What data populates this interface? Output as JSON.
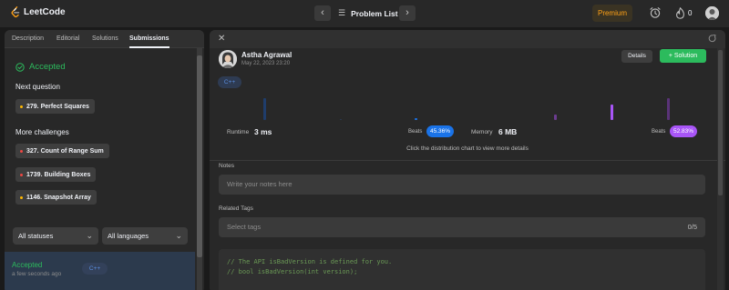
{
  "app": {
    "logo_text": "LeetCode"
  },
  "header": {
    "prev_glyph": "‹",
    "next_glyph": "›",
    "problem_list_label": "Problem List",
    "premium_label": "Premium",
    "streak_count": "0",
    "colors": {
      "premium": "#ffa116"
    }
  },
  "left": {
    "tabs": [
      {
        "label": "Description"
      },
      {
        "label": "Editorial"
      },
      {
        "label": "Solutions"
      },
      {
        "label": "Submissions",
        "active": true
      }
    ],
    "status": "Accepted",
    "next_question_label": "Next question",
    "next_question": {
      "label": "279. Perfect Squares",
      "difficulty_color": "#ffb800"
    },
    "more_challenges_label": "More challenges",
    "challenges": [
      {
        "label": "327. Count of Range Sum",
        "difficulty_color": "#ef4743"
      },
      {
        "label": "1739. Building Boxes",
        "difficulty_color": "#ef4743"
      },
      {
        "label": "1146. Snapshot Array",
        "difficulty_color": "#ffb800"
      }
    ],
    "status_filter": "All statuses",
    "language_filter": "All languages",
    "submission": {
      "status": "Accepted",
      "time": "a few seconds ago",
      "language": "C++"
    }
  },
  "right": {
    "author": {
      "name": "Astha Agrawal",
      "date": "May 22, 2023 23:20"
    },
    "details_label": "Details",
    "solution_label": "+ Solution",
    "language_badge": "C++",
    "runtime": {
      "label": "Runtime",
      "value": "3 ms",
      "beats_label": "Beats",
      "beats": "45.36%"
    },
    "memory": {
      "label": "Memory",
      "value": "6 MB",
      "beats_label": "Beats",
      "beats": "52.83%"
    },
    "dist_hint": "Click the distribution chart to view more details",
    "notes_label": "Notes",
    "notes_placeholder": "Write your notes here",
    "tags_label": "Related Tags",
    "tags_placeholder": "Select tags",
    "tags_count": "0/5",
    "code_lines": [
      "// The API isBadVersion is defined for you.",
      "// bool isBadVersion(int version);"
    ],
    "colors": {
      "accepted": "#2cbb5d",
      "runtime_badge": "#1a73e8",
      "memory_badge": "#a855f7"
    }
  }
}
